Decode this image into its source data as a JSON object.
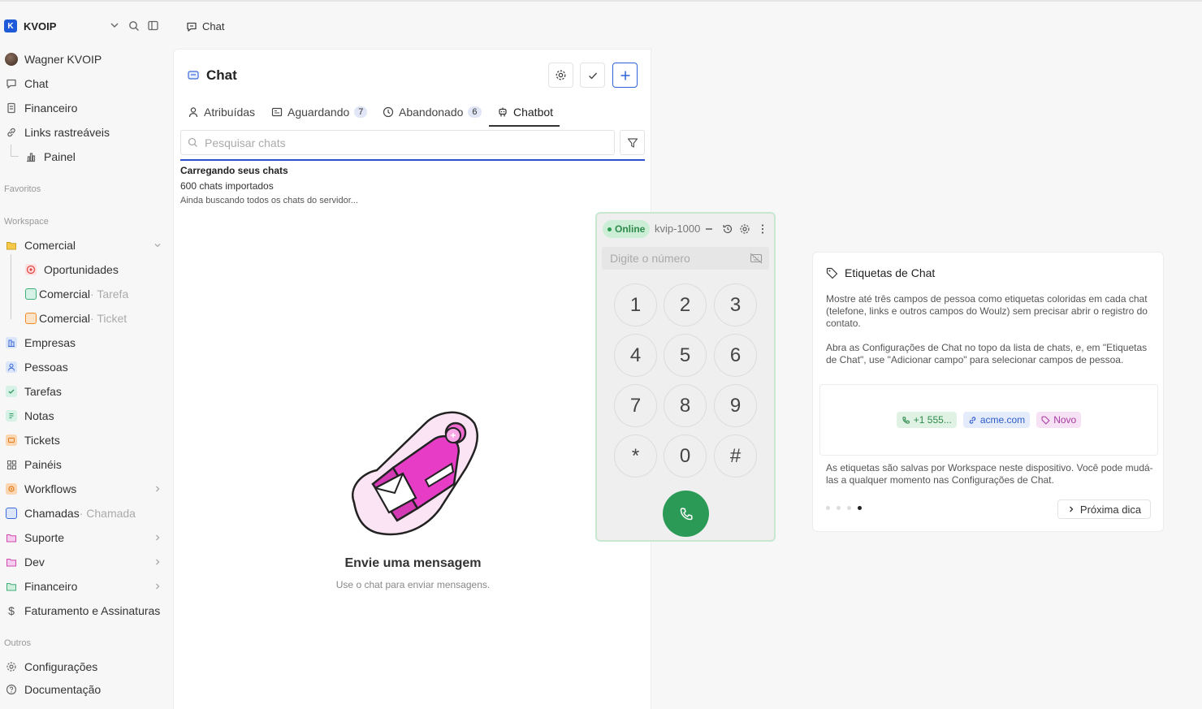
{
  "workspace": {
    "logo": "K",
    "name": "KVOIP"
  },
  "breadcrumb": {
    "label": "Chat"
  },
  "sidebar": {
    "user": "Wagner KVOIP",
    "top_items": [
      {
        "label": "Chat",
        "icon": "chat-icon"
      },
      {
        "label": "Financeiro",
        "icon": "receipt-icon"
      },
      {
        "label": "Links rastreáveis",
        "icon": "link-icon"
      },
      {
        "label": "Painel",
        "icon": "chart-icon"
      }
    ],
    "favoritos_label": "Favoritos",
    "workspace_label": "Workspace",
    "workspace_items": [
      {
        "label": "Comercial",
        "suffix": ""
      },
      {
        "label": "Oportunidades",
        "suffix": ""
      },
      {
        "label": "Comercial",
        "suffix": " · Tarefa"
      },
      {
        "label": "Comercial",
        "suffix": " · Ticket"
      },
      {
        "label": "Empresas",
        "suffix": ""
      },
      {
        "label": "Pessoas",
        "suffix": ""
      },
      {
        "label": "Tarefas",
        "suffix": ""
      },
      {
        "label": "Notas",
        "suffix": ""
      },
      {
        "label": "Tickets",
        "suffix": ""
      },
      {
        "label": "Painéis",
        "suffix": ""
      },
      {
        "label": "Workflows",
        "suffix": ""
      },
      {
        "label": "Chamadas",
        "suffix": " · Chamada"
      },
      {
        "label": "Suporte",
        "suffix": ""
      },
      {
        "label": "Dev",
        "suffix": ""
      },
      {
        "label": "Financeiro",
        "suffix": ""
      },
      {
        "label": "Faturamento e Assinaturas",
        "suffix": ""
      }
    ],
    "outros_label": "Outros",
    "outros_items": [
      {
        "label": "Configurações"
      },
      {
        "label": "Documentação"
      }
    ]
  },
  "chat": {
    "title": "Chat",
    "tabs": [
      {
        "label": "Atribuídas",
        "count": ""
      },
      {
        "label": "Aguardando",
        "count": "7"
      },
      {
        "label": "Abandonado",
        "count": "6"
      },
      {
        "label": "Chatbot",
        "count": ""
      }
    ],
    "search_placeholder": "Pesquisar chats",
    "loading_title": "Carregando seus chats",
    "loading_count": "600 chats importados",
    "loading_sub": "Ainda buscando todos os chats do servidor...",
    "empty_title": "Envie uma mensagem",
    "empty_sub": "Use o chat para enviar mensagens."
  },
  "dialer": {
    "status": "Online",
    "extension": "kvip-1000",
    "placeholder": "Digite o número",
    "keys": [
      "1",
      "2",
      "3",
      "4",
      "5",
      "6",
      "7",
      "8",
      "9",
      "*",
      "0",
      "#"
    ],
    "status_color": "#2d9c50"
  },
  "tip": {
    "title": "Etiquetas de Chat",
    "p1": "Mostre até três campos de pessoa como etiquetas coloridas em cada chat (telefone, links e outros campos do Woulz) sem precisar abrir o registro do contato.",
    "p2": "Abra as Configurações de Chat no topo da lista de chats, e, em \"Etiquetas de Chat\", use \"Adicionar campo\" para selecionar campos de pessoa.",
    "chips": [
      "+1 555...",
      "acme.com",
      "Novo"
    ],
    "p3": "As etiquetas são salvas por Workspace neste dispositivo. Você pode mudá-las a qualquer momento nas Configurações de Chat.",
    "next_label": "Próxima dica",
    "page_count": 4,
    "current_page": 4
  },
  "colors": {
    "accent": "#2d63d8",
    "call": "#2b9a57",
    "online_bg": "#cdeed6"
  }
}
